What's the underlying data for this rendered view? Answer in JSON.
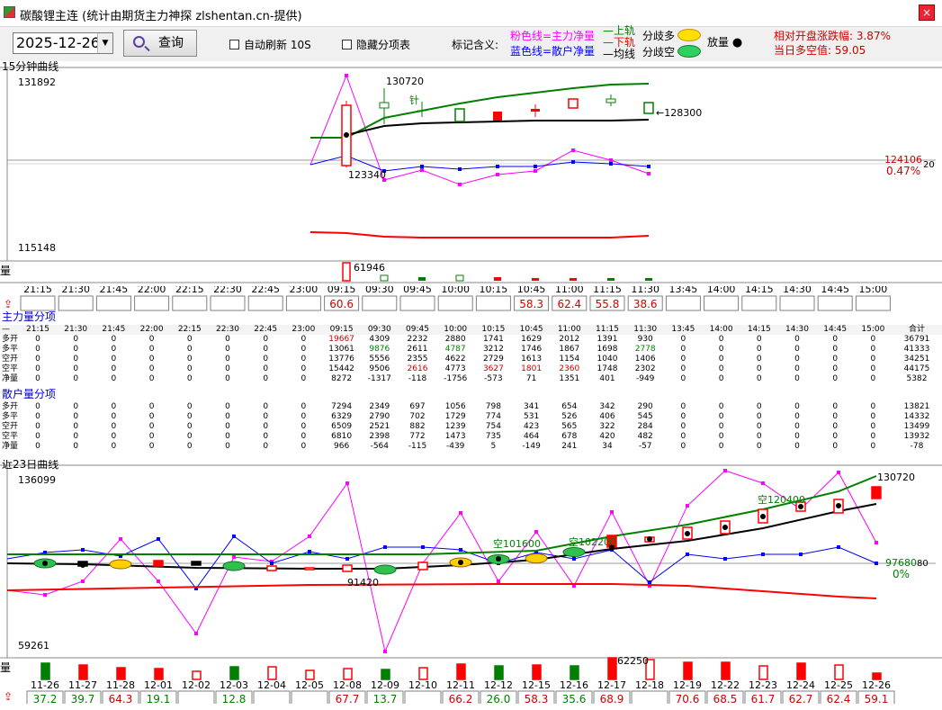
{
  "window": {
    "title": "碳酸锂主连 (统计由期货主力神探 zlshentan.cn-提供)",
    "close": "×"
  },
  "toolbar": {
    "date": "2025-12-26",
    "query": "查询",
    "auto_refresh": "自动刷新 10S",
    "hide_items": "隐藏分项表",
    "legend_label": "标记含义:",
    "pink_line": "粉色线=主力净量",
    "blue_line": "蓝色线=散户净量",
    "upper": "上轨",
    "lower": "下轨",
    "mid": "均线",
    "divergence_long": "分歧多",
    "divergence_short": "分歧空",
    "volume_up": "放量",
    "rel_change": "相对开盘涨跌幅: 3.87%",
    "long_short": "当日多空值: 59.05"
  },
  "colors": {
    "pink": "#ff00ff",
    "blue": "#0000ff",
    "green": "#008000",
    "red": "#ff0000",
    "black": "#000000"
  },
  "intraday": {
    "label": "15分钟曲线",
    "ymax": "131892",
    "ymin": "115148",
    "high_label": "130720",
    "low_label": "123340",
    "mid_label": "←128300",
    "ref_label": "124106",
    "ref_suffix": "20",
    "ref_pct": "0.47%",
    "needle": "针",
    "volume_label": "量",
    "volume_peak": "61946",
    "pct_icon": "⇪"
  },
  "time_slots": [
    "21:15",
    "21:30",
    "21:45",
    "22:00",
    "22:15",
    "22:30",
    "22:45",
    "23:00",
    "09:15",
    "09:30",
    "09:45",
    "10:00",
    "10:15",
    "10:45",
    "11:00",
    "11:15",
    "11:30",
    "13:45",
    "14:00",
    "14:15",
    "14:30",
    "14:45",
    "15:00"
  ],
  "slot_pcts": [
    "",
    "",
    "",
    "",
    "",
    "",
    "",
    "",
    "60.6",
    "",
    "",
    "",
    "",
    "58.3",
    "62.4",
    "55.8",
    "38.6",
    "",
    "",
    "",
    "",
    "",
    ""
  ],
  "main_table": {
    "title": "主力量分项",
    "dash": "—",
    "total": "合计",
    "rows": [
      {
        "label": "多开",
        "vals": [
          "0",
          "0",
          "0",
          "0",
          "0",
          "0",
          "0",
          "0",
          "19667",
          "4309",
          "2232",
          "2880",
          "1741",
          "1629",
          "2012",
          "1391",
          "930",
          "0",
          "0",
          "0",
          "0",
          "0",
          "0"
        ],
        "total": "36791"
      },
      {
        "label": "多平",
        "vals": [
          "0",
          "0",
          "0",
          "0",
          "0",
          "0",
          "0",
          "0",
          "13061",
          "9876",
          "2611",
          "4787",
          "3212",
          "1746",
          "1867",
          "1698",
          "2778",
          "0",
          "0",
          "0",
          "0",
          "0",
          "0"
        ],
        "total": "41333"
      },
      {
        "label": "空开",
        "vals": [
          "0",
          "0",
          "0",
          "0",
          "0",
          "0",
          "0",
          "0",
          "13776",
          "5556",
          "2355",
          "4622",
          "2729",
          "1613",
          "1154",
          "1040",
          "1406",
          "0",
          "0",
          "0",
          "0",
          "0",
          "0"
        ],
        "total": "34251"
      },
      {
        "label": "空平",
        "vals": [
          "0",
          "0",
          "0",
          "0",
          "0",
          "0",
          "0",
          "0",
          "15442",
          "9506",
          "2616",
          "4773",
          "3627",
          "1801",
          "2360",
          "1748",
          "2302",
          "0",
          "0",
          "0",
          "0",
          "0",
          "0"
        ],
        "total": "44175"
      },
      {
        "label": "净量",
        "vals": [
          "0",
          "0",
          "0",
          "0",
          "0",
          "0",
          "0",
          "0",
          "8272",
          "-1317",
          "-118",
          "-1756",
          "-573",
          "71",
          "1351",
          "401",
          "-949",
          "0",
          "0",
          "0",
          "0",
          "0",
          "0"
        ],
        "total": "5382"
      }
    ]
  },
  "retail_table": {
    "title": "散户量分项",
    "rows": [
      {
        "label": "多开",
        "vals": [
          "0",
          "0",
          "0",
          "0",
          "0",
          "0",
          "0",
          "0",
          "7294",
          "2349",
          "697",
          "1056",
          "798",
          "341",
          "654",
          "342",
          "290",
          "0",
          "0",
          "0",
          "0",
          "0",
          "0"
        ],
        "total": "13821"
      },
      {
        "label": "多平",
        "vals": [
          "0",
          "0",
          "0",
          "0",
          "0",
          "0",
          "0",
          "0",
          "6329",
          "2790",
          "702",
          "1729",
          "774",
          "531",
          "526",
          "406",
          "545",
          "0",
          "0",
          "0",
          "0",
          "0",
          "0"
        ],
        "total": "14332"
      },
      {
        "label": "空开",
        "vals": [
          "0",
          "0",
          "0",
          "0",
          "0",
          "0",
          "0",
          "0",
          "6509",
          "2521",
          "882",
          "1239",
          "754",
          "423",
          "565",
          "322",
          "284",
          "0",
          "0",
          "0",
          "0",
          "0",
          "0"
        ],
        "total": "13499"
      },
      {
        "label": "空平",
        "vals": [
          "0",
          "0",
          "0",
          "0",
          "0",
          "0",
          "0",
          "0",
          "6810",
          "2398",
          "772",
          "1473",
          "735",
          "464",
          "678",
          "420",
          "482",
          "0",
          "0",
          "0",
          "0",
          "0",
          "0"
        ],
        "total": "13932"
      },
      {
        "label": "净量",
        "vals": [
          "0",
          "0",
          "0",
          "0",
          "0",
          "0",
          "0",
          "0",
          "966",
          "-564",
          "-115",
          "-439",
          "5",
          "-149",
          "241",
          "34",
          "-57",
          "0",
          "0",
          "0",
          "0",
          "0",
          "0"
        ],
        "total": "-78"
      }
    ]
  },
  "daily": {
    "label": "近23日曲线",
    "ymax": "136099",
    "ymin": "59261",
    "high_label": "130720",
    "low_label": "91420",
    "ref_label": "97680",
    "ref_suffix": "80",
    "ref_pct": "0%",
    "empty1": "空101600",
    "empty2": "空102200",
    "empty3": "空120400",
    "volume_label": "量",
    "volume_peak": "62250",
    "pct_icon": "⇪"
  },
  "days": [
    "11-26",
    "11-27",
    "11-28",
    "12-01",
    "12-02",
    "12-03",
    "12-04",
    "12-05",
    "12-08",
    "12-09",
    "12-10",
    "12-11",
    "12-12",
    "12-15",
    "12-16",
    "12-17",
    "12-18",
    "12-19",
    "12-22",
    "12-23",
    "12-24",
    "12-25",
    "12-26"
  ],
  "day_pcts": [
    "37.2",
    "39.7",
    "64.3",
    "19.1",
    "",
    "12.8",
    "",
    "",
    "67.7",
    "13.7",
    "",
    "66.2",
    "26.0",
    "58.3",
    "35.6",
    "68.9",
    "",
    "70.6",
    "68.5",
    "61.7",
    "62.7",
    "62.4",
    "59.1"
  ],
  "chart_data": [
    {
      "type": "line",
      "title": "15分钟曲线",
      "x": [
        "09:15",
        "09:30",
        "09:45",
        "10:00",
        "10:15",
        "10:45",
        "11:00",
        "11:15",
        "11:30"
      ],
      "ylim": [
        115148,
        131892
      ],
      "series": []
    },
    {
      "type": "line",
      "title": "近23日曲线",
      "x": [
        "11-26",
        "11-27",
        "11-28",
        "12-01",
        "12-02",
        "12-03",
        "12-04",
        "12-05",
        "12-08",
        "12-09",
        "12-10",
        "12-11",
        "12-12",
        "12-15",
        "12-16",
        "12-17",
        "12-18",
        "12-19",
        "12-22",
        "12-23",
        "12-24",
        "12-25",
        "12-26"
      ],
      "ylim": [
        59261,
        136099
      ],
      "series": []
    }
  ]
}
